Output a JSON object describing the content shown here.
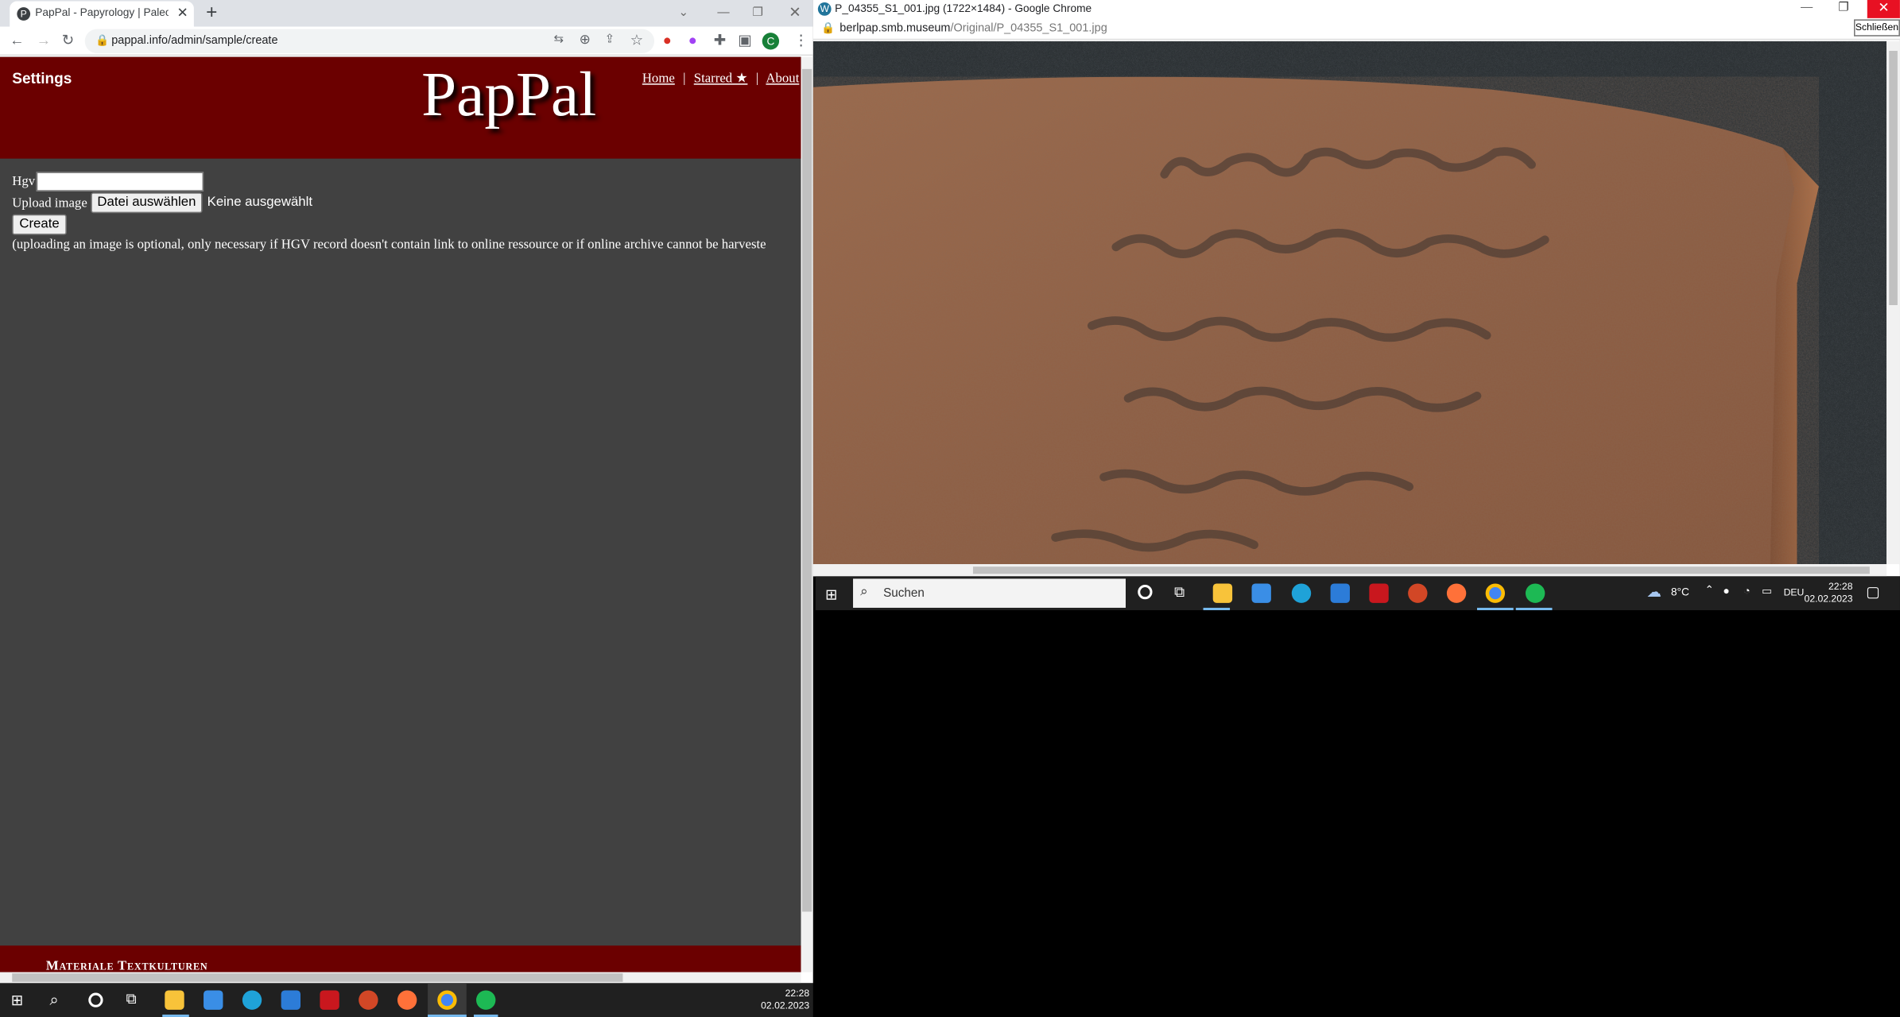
{
  "left_window": {
    "tab_title": "PapPal - Papyrology | Paleograph",
    "url": "pappal.info/admin/sample/create",
    "avatar_letter": "C",
    "site": {
      "settings_label": "Settings",
      "logo": "PapPal",
      "nav": {
        "home": "Home",
        "starred": "Starred ★",
        "about": "About",
        "sep": "|"
      },
      "form": {
        "hgv_label": "Hgv",
        "upload_label": "Upload image",
        "file_button": "Datei auswählen",
        "file_status": "Keine ausgewählt",
        "create_button": "Create",
        "note": "(uploading an image is optional, only necessary if HGV record doesn't contain link to online ressource or if online archive cannot be harveste"
      },
      "footer": "Materiale Textkulturen"
    }
  },
  "right_window": {
    "title": "P_04355_S1_001.jpg (1722×1484) - Google Chrome",
    "url_host": "berlpap.smb.museum",
    "url_path": "/Original/P_04355_S1_001.jpg",
    "tooltip": "Schließen"
  },
  "taskbar_right": {
    "search_placeholder": "Suchen",
    "weather": "8°C",
    "language": "DEU",
    "time": "22:28",
    "date": "02.02.2023"
  },
  "taskbar_left": {
    "time": "22:28",
    "date": "02.02.2023"
  },
  "colors": {
    "banner": "#6b0000",
    "page_bg": "#414141"
  }
}
